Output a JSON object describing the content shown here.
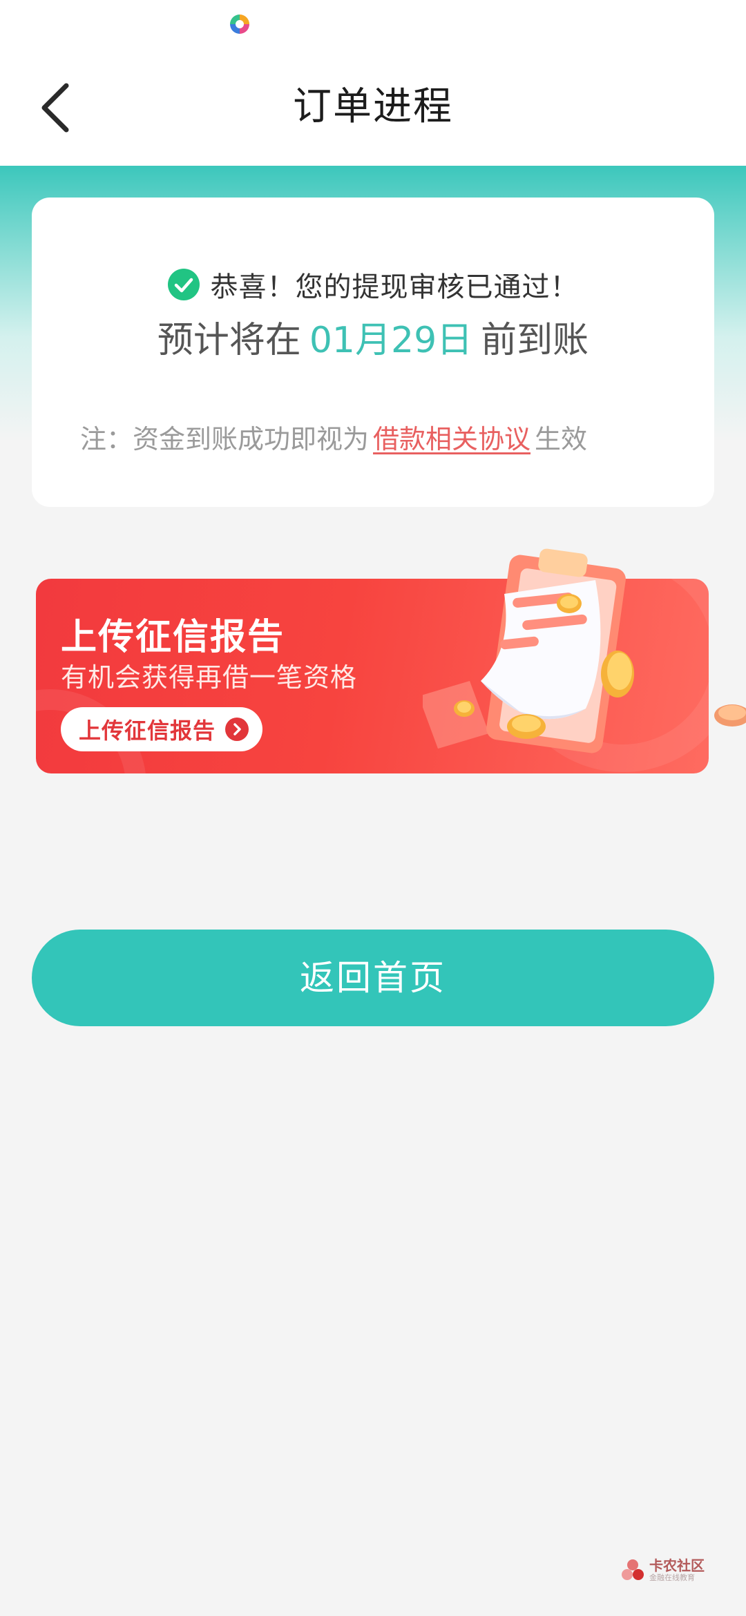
{
  "header": {
    "title": "订单进程",
    "back_icon": "chevron-left-icon",
    "status_app_icon": "app-logo-icon"
  },
  "status_card": {
    "approved_text": "恭喜！您的提现审核已通过！",
    "eta_prefix": "预计将在",
    "eta_date": "01月29日",
    "eta_suffix": "前到账",
    "note_prefix": "注：资金到账成功即视为",
    "note_link": "借款相关协议",
    "note_suffix": "生效"
  },
  "promo": {
    "title": "上传征信报告",
    "subtitle": "有机会获得再借一笔资格",
    "cta_label": "上传征信报告"
  },
  "actions": {
    "home_label": "返回首页"
  },
  "watermark": {
    "title": "卡农社区",
    "subtitle": "金融在线教育"
  },
  "colors": {
    "accent_teal": "#33c5b9",
    "success_green": "#21c483",
    "promo_red": "#f23a3e",
    "link_red": "#e86060"
  }
}
